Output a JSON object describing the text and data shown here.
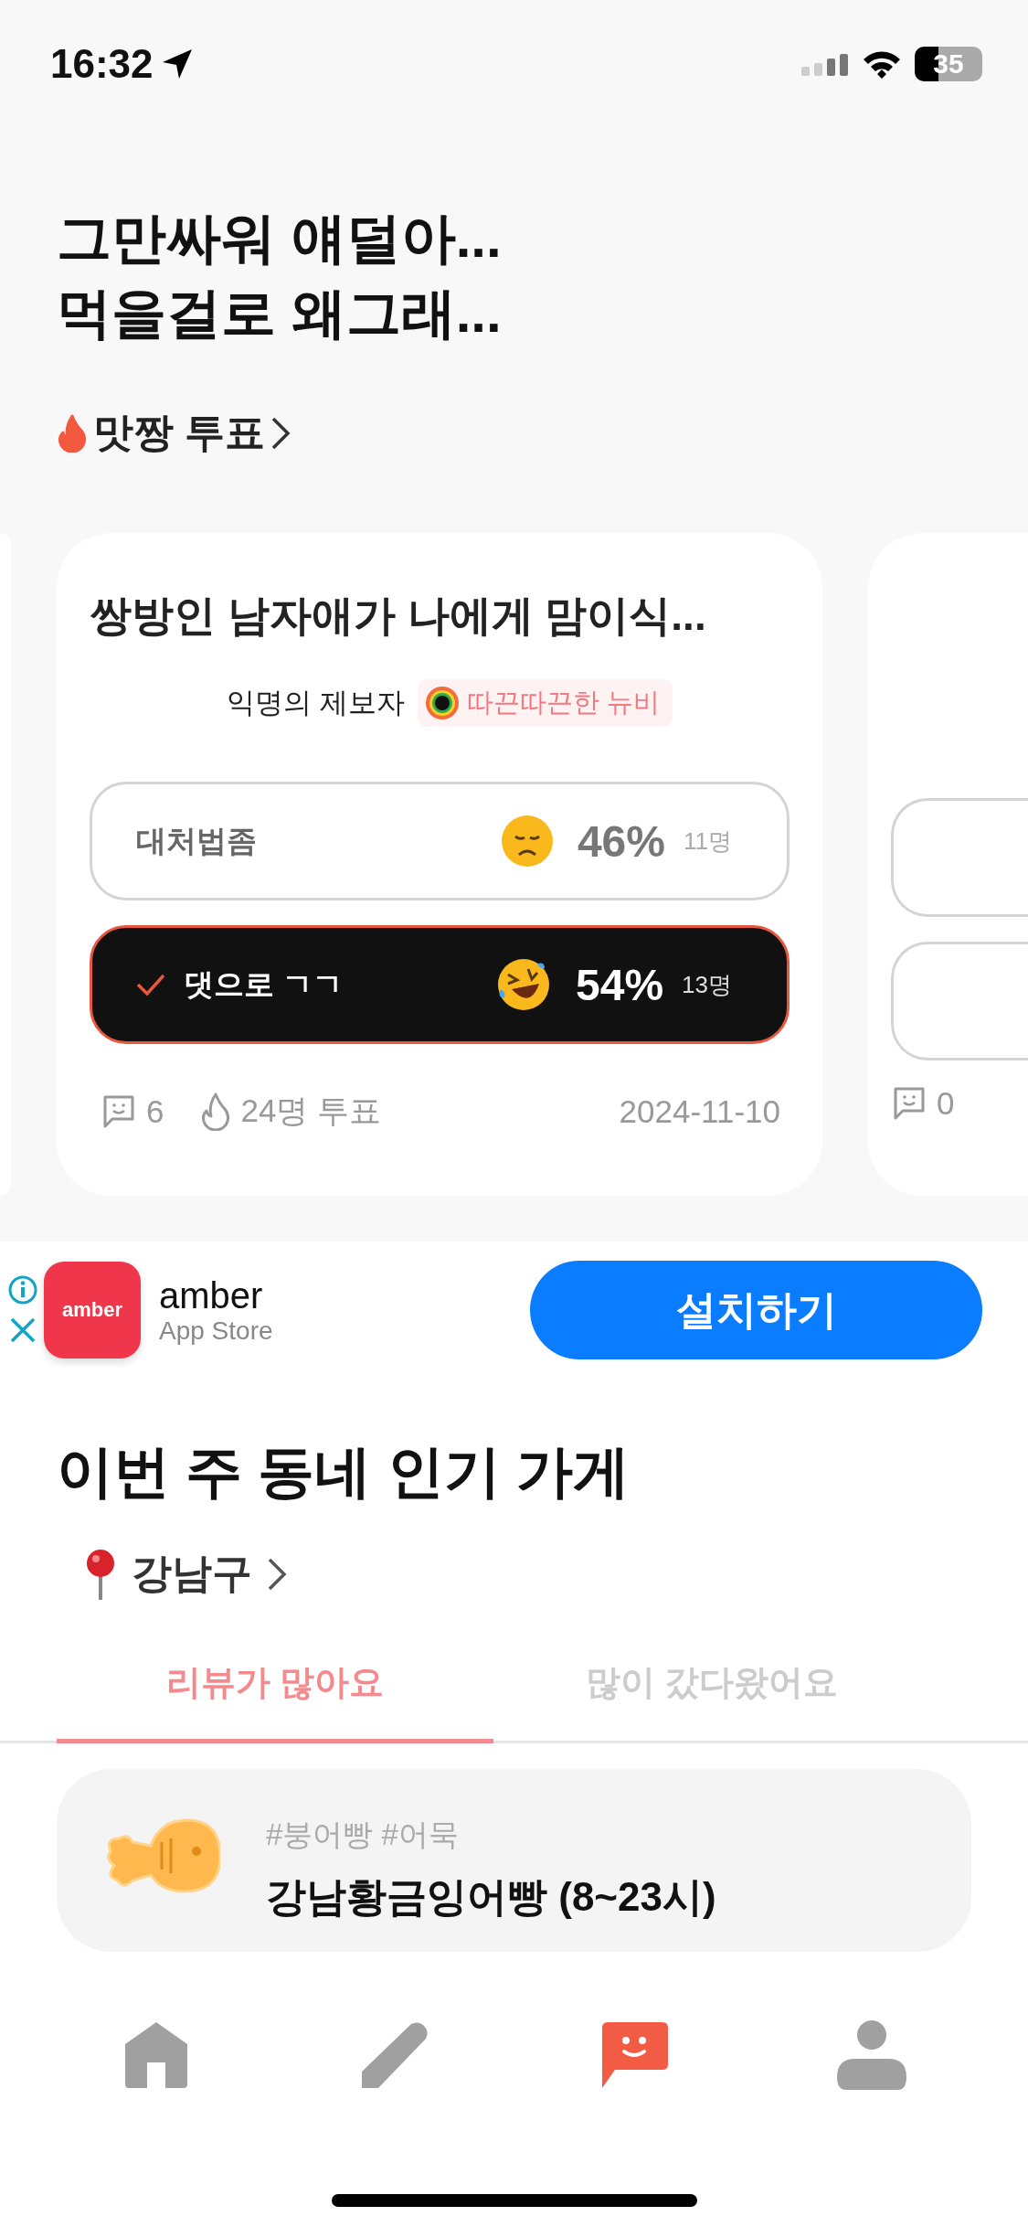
{
  "status_bar": {
    "time": "16:32",
    "battery": "35"
  },
  "headline": [
    "그만싸워 얘덜아...",
    "먹을걸로 왜그래..."
  ],
  "vote_section": {
    "title": "맛짱 투표"
  },
  "vote_card": {
    "title": "쌍방인 남자애가 나에게 맘이식...",
    "author": "익명의 제보자",
    "badge": "따끈따끈한 뉴비",
    "options": [
      {
        "label": "대처법좀",
        "percent": "46%",
        "count": "11명",
        "selected": false
      },
      {
        "label": "댓으로 ㄱㄱ",
        "percent": "54%",
        "count": "13명",
        "selected": true
      }
    ],
    "comments": "6",
    "votes": "24명 투표",
    "date": "2024-11-10"
  },
  "next_card": {
    "comments": "0"
  },
  "ad": {
    "icon_text": "amber",
    "app_name": "amber",
    "store": "App Store",
    "button": "설치하기"
  },
  "popular": {
    "title": "이번 주 동네 인기 가게",
    "location": "강남구",
    "tabs": [
      {
        "label": "리뷰가 많아요",
        "selected": true
      },
      {
        "label": "많이 갔다왔어요",
        "selected": false
      }
    ],
    "stores": [
      {
        "tags": "#붕어빵 #어묵",
        "name": "강남황금잉어빵 (8~23시)"
      }
    ]
  },
  "bottom_nav": [
    {
      "kind": "home",
      "selected": false
    },
    {
      "kind": "write",
      "selected": false
    },
    {
      "kind": "chat",
      "selected": true
    },
    {
      "kind": "profile",
      "selected": false
    }
  ]
}
